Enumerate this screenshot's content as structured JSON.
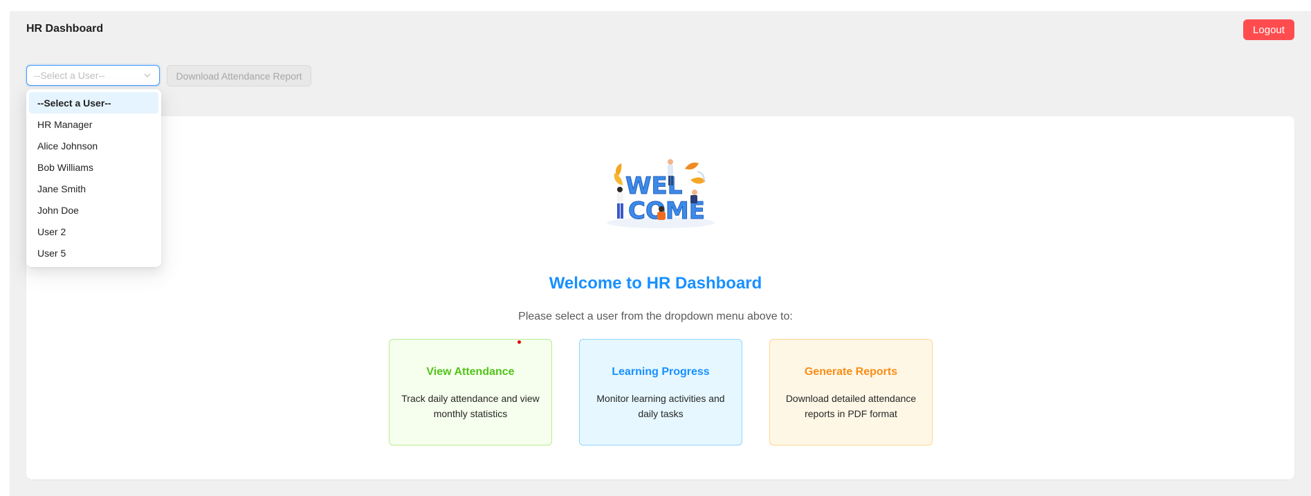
{
  "header": {
    "title": "HR Dashboard",
    "logout_label": "Logout"
  },
  "toolbar": {
    "select_placeholder": "--Select a User--",
    "download_label": "Download Attendance Report"
  },
  "dropdown": {
    "options": [
      "--Select a User--",
      "HR Manager",
      "Alice Johnson",
      "Bob Williams",
      "Jane Smith",
      "John Doe",
      "User 2",
      "User 5"
    ]
  },
  "welcome": {
    "image_text_top": "WEL",
    "image_text_bottom": "COME",
    "heading": "Welcome to HR Dashboard",
    "subtitle": "Please select a user from the dropdown menu above to:"
  },
  "features": [
    {
      "title": "View Attendance",
      "description": "Track daily attendance and view monthly statistics",
      "color": "#52c41a"
    },
    {
      "title": "Learning Progress",
      "description": "Monitor learning activities and daily tasks",
      "color": "#1890ff"
    },
    {
      "title": "Generate Reports",
      "description": "Download detailed attendance reports in PDF format",
      "color": "#fa8c16"
    }
  ],
  "colors": {
    "accent": "#1890ff",
    "danger": "#ff4d4f",
    "background": "#f0f0f0"
  }
}
